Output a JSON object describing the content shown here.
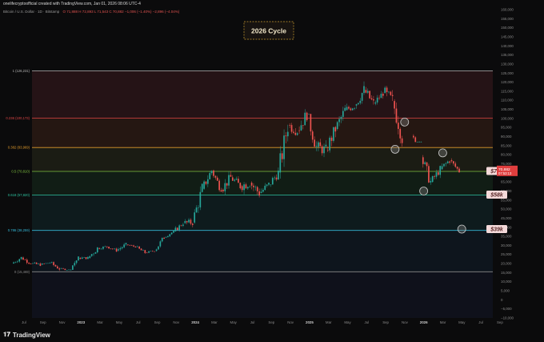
{
  "header": {
    "credit": "onelifecryptoofficial created with TradingView.com, Jan 01, 2026 08:06 UTC-4",
    "symbol": "Bitcoin / U.S. Dollar · 1D · Bitstamp",
    "ohlc": "O 71,888 H 72,893 L 71,543 C 70,882 −1,006 (−1.40%) −2,896 (−4.04%)"
  },
  "footer": {
    "brand": "TradingView",
    "logo_icon": "tradingview-logo-icon"
  },
  "annotation": {
    "title": "2026 Cycle"
  },
  "price_badges": {
    "current": "70,882",
    "sub": "07:53:13",
    "color": "#e03e3e"
  },
  "colors": {
    "up": "#26a69a",
    "down": "#ef5350",
    "fib_1": "#b5b5b5",
    "fib_0618": "#e04646",
    "fib_0382": "#e09a2c",
    "fib_05": "#7fc241",
    "fib_0618low": "#2ec4a0",
    "fib_0786": "#35b7d6",
    "fib_0": "#8a8a8a",
    "circle": "#c9c9c9",
    "label_bg": "#f4d9d9",
    "label_text": "#5b2a2a"
  },
  "chart_data": {
    "type": "candlestick",
    "title": "2026 Cycle",
    "ylim": [
      -10000,
      160000
    ],
    "y_ticks": [
      "160,000",
      "155,000",
      "150,000",
      "145,000",
      "140,000",
      "135,000",
      "130,000",
      "125,000",
      "120,000",
      "115,000",
      "110,000",
      "105,000",
      "100,000",
      "95,000",
      "90,000",
      "85,000",
      "80,000",
      "75,000",
      "70,000",
      "65,000",
      "60,000",
      "55,000",
      "50,000",
      "45,000",
      "40,000",
      "35,000",
      "30,000",
      "25,000",
      "20,000",
      "15,000",
      "10,000",
      "5,000",
      "0",
      "−5,000",
      "−10,000"
    ],
    "x_ticks": [
      "Jul",
      "Sep",
      "Nov",
      "2023",
      "Mar",
      "May",
      "Jul",
      "Sep",
      "Nov",
      "2024",
      "Mar",
      "May",
      "Jul",
      "Sep",
      "Nov",
      "2025",
      "Mar",
      "May",
      "Jul",
      "Sep",
      "Nov",
      "2026",
      "Mar",
      "May",
      "Jul",
      "Sep"
    ],
    "fib_levels": [
      {
        "label": "1 (126,231)",
        "value": 126231
      },
      {
        "label": "0.236 (100,173)",
        "value": 100173
      },
      {
        "label": "0.382 (83,969)",
        "value": 83969
      },
      {
        "label": "0.5 (70,810)",
        "value": 70810
      },
      {
        "label": "0.618 (57,820)",
        "value": 57820
      },
      {
        "label": "0.786 (38,259)",
        "value": 38259
      },
      {
        "label": "0 (15,469)",
        "value": 15469
      }
    ],
    "series_monthly": [
      {
        "t": "2022-07",
        "o": 20000,
        "h": 24500,
        "l": 18800,
        "c": 23300
      },
      {
        "t": "2022-08",
        "o": 23300,
        "h": 25200,
        "l": 19600,
        "c": 20000
      },
      {
        "t": "2022-09",
        "o": 20000,
        "h": 22700,
        "l": 18200,
        "c": 19400
      },
      {
        "t": "2022-10",
        "o": 19400,
        "h": 21000,
        "l": 18200,
        "c": 20500
      },
      {
        "t": "2022-11",
        "o": 20500,
        "h": 21400,
        "l": 15500,
        "c": 17200
      },
      {
        "t": "2022-12",
        "o": 17200,
        "h": 18400,
        "l": 16300,
        "c": 16500
      },
      {
        "t": "2023-01",
        "o": 16500,
        "h": 23900,
        "l": 16500,
        "c": 23100
      },
      {
        "t": "2023-02",
        "o": 23100,
        "h": 25200,
        "l": 21400,
        "c": 23100
      },
      {
        "t": "2023-03",
        "o": 23100,
        "h": 29200,
        "l": 19600,
        "c": 28500
      },
      {
        "t": "2023-04",
        "o": 28500,
        "h": 31000,
        "l": 26900,
        "c": 29300
      },
      {
        "t": "2023-05",
        "o": 29300,
        "h": 29800,
        "l": 25800,
        "c": 27200
      },
      {
        "t": "2023-06",
        "o": 27200,
        "h": 31400,
        "l": 24800,
        "c": 30500
      },
      {
        "t": "2023-07",
        "o": 30500,
        "h": 31800,
        "l": 28900,
        "c": 29200
      },
      {
        "t": "2023-08",
        "o": 29200,
        "h": 30200,
        "l": 25300,
        "c": 26000
      },
      {
        "t": "2023-09",
        "o": 26000,
        "h": 27400,
        "l": 24900,
        "c": 27000
      },
      {
        "t": "2023-10",
        "o": 27000,
        "h": 35200,
        "l": 26600,
        "c": 34500
      },
      {
        "t": "2023-11",
        "o": 34500,
        "h": 38400,
        "l": 34100,
        "c": 37700
      },
      {
        "t": "2023-12",
        "o": 37700,
        "h": 44700,
        "l": 37600,
        "c": 42300
      },
      {
        "t": "2024-01",
        "o": 42300,
        "h": 48900,
        "l": 38600,
        "c": 42600
      },
      {
        "t": "2024-02",
        "o": 42600,
        "h": 64000,
        "l": 41900,
        "c": 61200
      },
      {
        "t": "2024-03",
        "o": 61200,
        "h": 73800,
        "l": 59000,
        "c": 71300
      },
      {
        "t": "2024-04",
        "o": 71300,
        "h": 72800,
        "l": 59600,
        "c": 60700
      },
      {
        "t": "2024-05",
        "o": 60700,
        "h": 71900,
        "l": 56600,
        "c": 67500
      },
      {
        "t": "2024-06",
        "o": 67500,
        "h": 71900,
        "l": 58500,
        "c": 62700
      },
      {
        "t": "2024-07",
        "o": 62700,
        "h": 70000,
        "l": 53500,
        "c": 64600
      },
      {
        "t": "2024-08",
        "o": 64600,
        "h": 65600,
        "l": 49000,
        "c": 58900
      },
      {
        "t": "2024-09",
        "o": 58900,
        "h": 66500,
        "l": 52600,
        "c": 63300
      },
      {
        "t": "2024-10",
        "o": 63300,
        "h": 73600,
        "l": 58900,
        "c": 70200
      },
      {
        "t": "2024-11",
        "o": 70200,
        "h": 99600,
        "l": 66800,
        "c": 96400
      },
      {
        "t": "2024-12",
        "o": 96400,
        "h": 108300,
        "l": 90500,
        "c": 93400
      },
      {
        "t": "2025-01",
        "o": 93400,
        "h": 109100,
        "l": 89200,
        "c": 102400
      },
      {
        "t": "2025-02",
        "o": 102400,
        "h": 102500,
        "l": 78200,
        "c": 84300
      },
      {
        "t": "2025-03",
        "o": 84300,
        "h": 95000,
        "l": 76600,
        "c": 82500
      },
      {
        "t": "2025-04",
        "o": 82500,
        "h": 95800,
        "l": 74400,
        "c": 94200
      },
      {
        "t": "2025-05",
        "o": 94200,
        "h": 111900,
        "l": 93400,
        "c": 104600
      },
      {
        "t": "2025-06",
        "o": 104600,
        "h": 110400,
        "l": 98200,
        "c": 107100
      },
      {
        "t": "2025-07",
        "o": 107100,
        "h": 123200,
        "l": 105300,
        "c": 115700
      },
      {
        "t": "2025-08",
        "o": 115700,
        "h": 124500,
        "l": 107300,
        "c": 108200
      },
      {
        "t": "2025-09",
        "o": 108200,
        "h": 117900,
        "l": 107300,
        "c": 114000
      },
      {
        "t": "2025-10",
        "o": 114000,
        "h": 126231,
        "l": 103500,
        "c": 109600
      },
      {
        "t": "2025-11",
        "o": 109600,
        "h": 110600,
        "l": 80600,
        "c": 90400
      },
      {
        "t": "2026-01",
        "o": 90400,
        "h": 97900,
        "l": 87000,
        "c": 78600
      },
      {
        "t": "2026-02",
        "o": 78600,
        "h": 80000,
        "l": 60000,
        "c": 65000
      },
      {
        "t": "2026-03",
        "o": 65000,
        "h": 74000,
        "l": 62000,
        "c": 72000
      },
      {
        "t": "2026-04",
        "o": 72000,
        "h": 81000,
        "l": 70000,
        "c": 77000
      },
      {
        "t": "2026-05",
        "o": 77000,
        "h": 79000,
        "l": 70200,
        "c": 70882
      }
    ],
    "circled_points": [
      {
        "t": "2025-11",
        "value": 83000
      },
      {
        "t": "2025-12",
        "value": 98000
      },
      {
        "t": "2026-02",
        "value": 60000
      },
      {
        "t": "2026-04",
        "value": 81000
      },
      {
        "t": "2026-06",
        "value": 39000
      }
    ],
    "target_labels": [
      {
        "text": "$71k",
        "value": 71000
      },
      {
        "text": "$58k",
        "value": 58000
      },
      {
        "text": "$39k",
        "value": 39000
      }
    ]
  }
}
